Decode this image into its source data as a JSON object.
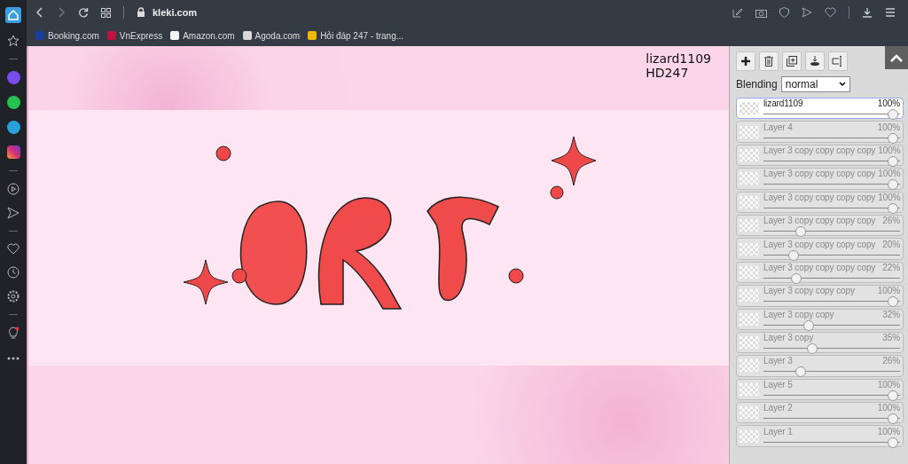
{
  "browser": {
    "url": "kleki.com",
    "bookmarks": [
      {
        "label": "Booking.com",
        "color": "#1a3f9c"
      },
      {
        "label": "VnExpress",
        "color": "#c4123f"
      },
      {
        "label": "Amazon.com",
        "color": "#f5f5f5"
      },
      {
        "label": "Agoda.com",
        "color": "#d8d8d8"
      },
      {
        "label": "Hỏi đáp 247 - trang...",
        "color": "#f2b705"
      }
    ]
  },
  "canvas": {
    "signature": [
      "lizard1109",
      "HD247"
    ]
  },
  "layers_panel": {
    "blending_label": "Blending",
    "blending_value": "normal",
    "layers": [
      {
        "name": "lizard1109",
        "opacity": "100%",
        "level": 1,
        "selected": true
      },
      {
        "name": "Layer 4",
        "opacity": "100%",
        "level": 1,
        "selected": false
      },
      {
        "name": "Layer 3 copy copy copy copy",
        "opacity": "100%",
        "level": 1,
        "selected": false
      },
      {
        "name": "Layer 3 copy copy copy copy",
        "opacity": "100%",
        "level": 1,
        "selected": false
      },
      {
        "name": "Layer 3 copy copy copy copy",
        "opacity": "100%",
        "level": 1,
        "selected": false
      },
      {
        "name": "Layer 3 copy copy copy copy",
        "opacity": "26%",
        "level": 0.26,
        "selected": false
      },
      {
        "name": "Layer 3 copy copy copy copy",
        "opacity": "20%",
        "level": 0.2,
        "selected": false
      },
      {
        "name": "Layer 3 copy copy copy copy",
        "opacity": "22%",
        "level": 0.22,
        "selected": false
      },
      {
        "name": "Layer 3 copy copy copy",
        "opacity": "100%",
        "level": 1,
        "selected": false
      },
      {
        "name": "Layer 3 copy copy",
        "opacity": "32%",
        "level": 0.32,
        "selected": false
      },
      {
        "name": "Layer 3 copy",
        "opacity": "35%",
        "level": 0.35,
        "selected": false
      },
      {
        "name": "Layer 3",
        "opacity": "26%",
        "level": 0.26,
        "selected": false
      },
      {
        "name": "Layer 5",
        "opacity": "100%",
        "level": 1,
        "selected": false
      },
      {
        "name": "Layer 2",
        "opacity": "100%",
        "level": 1,
        "selected": false
      },
      {
        "name": "Layer 1",
        "opacity": "100%",
        "level": 1,
        "selected": false
      }
    ]
  }
}
